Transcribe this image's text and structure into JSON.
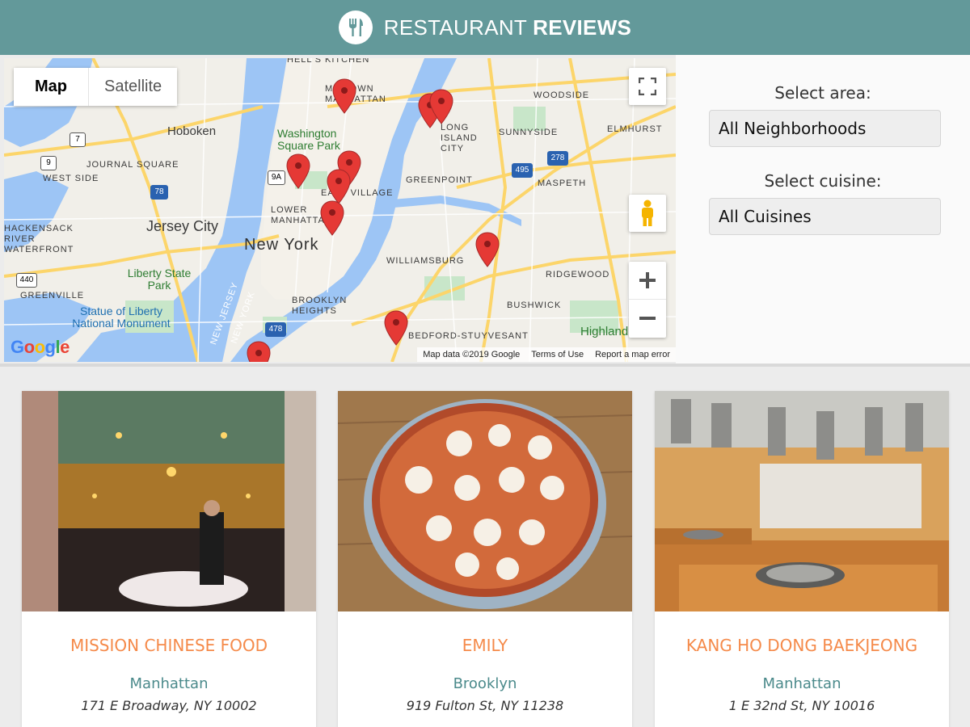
{
  "header": {
    "logo_icon": "fork-knife-icon",
    "title_light": "RESTAURANT",
    "title_bold": "REVIEWS"
  },
  "map": {
    "type_buttons": [
      "Map",
      "Satellite"
    ],
    "active_type": "Map",
    "labels": [
      "HELL'S KITCHEN",
      "MIDTOWN MANHATTAN",
      "Hoboken",
      "Washington Square Park",
      "WOODSIDE",
      "SUNNYSIDE",
      "LONG ISLAND CITY",
      "JOURNAL SQUARE",
      "WEST SIDE",
      "EAST VILLAGE",
      "LOWER MANHATTAN",
      "GREENPOINT",
      "MASPETH",
      "ELMHURST",
      "Jersey City",
      "New York",
      "HACKENSACK RIVER WATERFRONT",
      "Liberty State Park",
      "WILLIAMSBURG",
      "RIDGEWOOD",
      "GREENVILLE",
      "Statue of Liberty National Monument",
      "NEW JERSEY",
      "NEW YORK",
      "BROOKLYN HEIGHTS",
      "BUSHWICK",
      "BEDFORD-STUYVESANT",
      "Highland"
    ],
    "shields": [
      "7",
      "9",
      "9A",
      "78",
      "495",
      "278",
      "440",
      "478"
    ],
    "attribution": [
      "Map data ©2019 Google",
      "Terms of Use",
      "Report a map error"
    ],
    "google_logo": "Google",
    "controls": [
      "fullscreen-icon",
      "pegman-icon",
      "zoom-in-icon",
      "zoom-out-icon"
    ]
  },
  "filters": {
    "area_label": "Select area:",
    "area_value": "All Neighborhoods",
    "cuisine_label": "Select cuisine:",
    "cuisine_value": "All Cuisines"
  },
  "restaurants": [
    {
      "name": "MISSION CHINESE FOOD",
      "neighborhood": "Manhattan",
      "address": "171 E Broadway, NY 10002"
    },
    {
      "name": "EMILY",
      "neighborhood": "Brooklyn",
      "address": "919 Fulton St, NY 11238"
    },
    {
      "name": "KANG HO DONG BAEKJEONG",
      "neighborhood": "Manhattan",
      "address": "1 E 32nd St, NY 10016"
    }
  ],
  "colors": {
    "header_bg": "#63999a",
    "name": "#f58a4a",
    "neighborhood": "#4b8a8b",
    "pin": "#e53935"
  }
}
